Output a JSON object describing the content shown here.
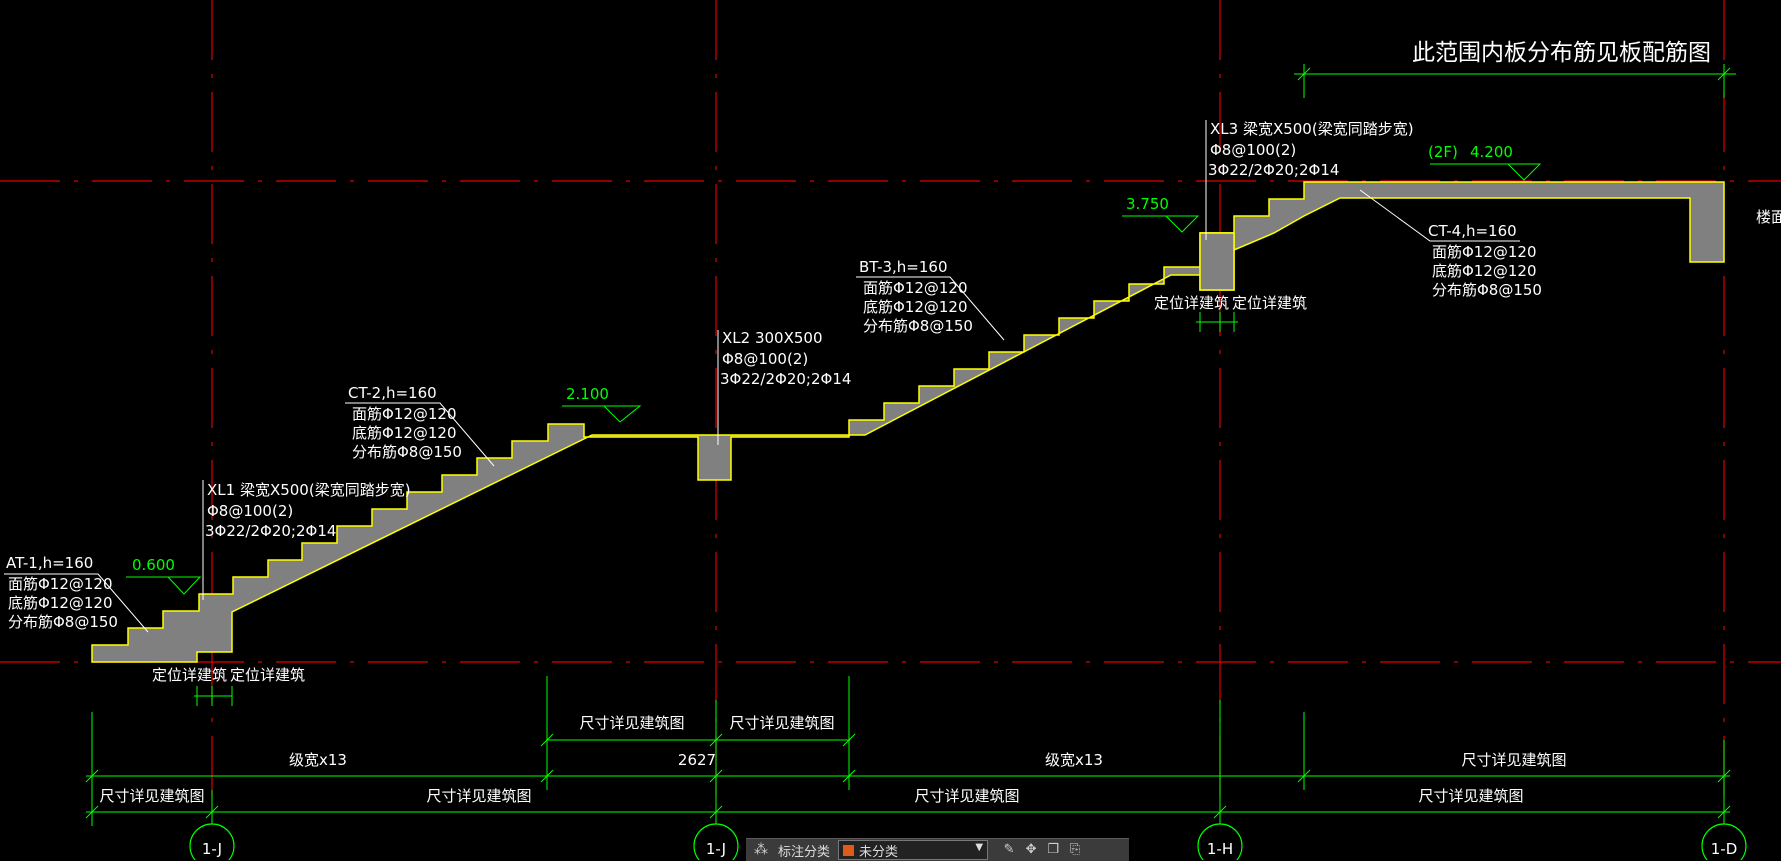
{
  "heading": "此范围内板分布筋见板配筋图",
  "flights": {
    "at1": {
      "title": "AT-1,h=160",
      "top": "面筋Φ12@120",
      "bottom": "底筋Φ12@120",
      "dist": "分布筋Φ8@150"
    },
    "ct2": {
      "title": "CT-2,h=160",
      "top": "面筋Φ12@120",
      "bottom": "底筋Φ12@120",
      "dist": "分布筋Φ8@150"
    },
    "bt3": {
      "title": "BT-3,h=160",
      "top": "面筋Φ12@120",
      "bottom": "底筋Φ12@120",
      "dist": "分布筋Φ8@150"
    },
    "ct4": {
      "title": "CT-4,h=160",
      "top": "面筋Φ12@120",
      "bottom": "底筋Φ12@120",
      "dist": "分布筋Φ8@150"
    }
  },
  "beams": {
    "xl1": {
      "title": "XL1 梁宽X500(梁宽同踏步宽)",
      "stirrup": "Φ8@100(2)",
      "bars": "3Φ22/2Φ20;2Φ14"
    },
    "xl2": {
      "title": "XL2 300X500",
      "stirrup": "Φ8@100(2)",
      "bars": "3Φ22/2Φ20;2Φ14"
    },
    "xl3": {
      "title": "XL3 梁宽X500(梁宽同踏步宽)",
      "stirrup": "Φ8@100(2)",
      "bars": "3Φ22/2Φ20;2Φ14"
    }
  },
  "elevations": {
    "e1": "0.600",
    "e2": "2.100",
    "e3": "3.750",
    "e4_prefix": "(2F)",
    "e4": "4.200"
  },
  "notes": {
    "locate_1": "定位详建筑",
    "locate_2": "定位详建筑",
    "locate_3": "定位详建筑",
    "locate_4": "定位详建筑",
    "edge_right": "楼面梁"
  },
  "dimensions": {
    "row1_a": "尺寸详见建筑图",
    "row1_b": "尺寸详见建筑图",
    "row2_a": "级宽x13",
    "row2_b": "2627",
    "row2_c": "级宽x13",
    "row2_d": "尺寸详见建筑图",
    "row3_a": "尺寸详见建筑图",
    "row3_b": "尺寸详见建筑图",
    "row3_c": "尺寸详见建筑图",
    "row3_d": "尺寸详见建筑图"
  },
  "axes": {
    "a1": "1-J",
    "a2": "1-J",
    "a3": "1-H",
    "a4": "1-D"
  },
  "toolbar": {
    "label": "标注分类",
    "selected": "未分类",
    "swatch_color": "#e05a1a"
  },
  "colors": {
    "axis_line": "#e00000",
    "dimension": "#00ff00",
    "concrete": "#808080",
    "outline": "#ffff00",
    "text": "#ffffff"
  }
}
